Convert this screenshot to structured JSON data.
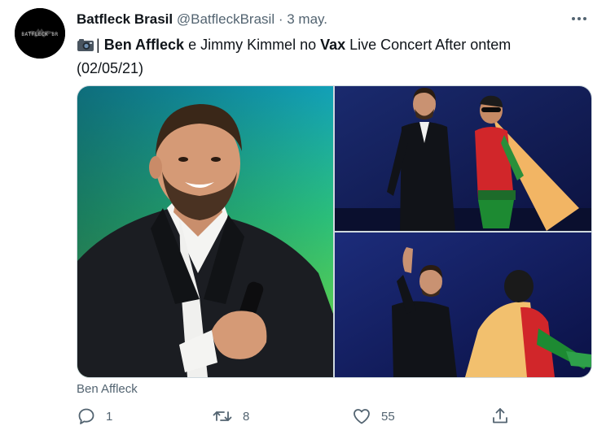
{
  "author": {
    "name": "Batfleck Brasil",
    "handle": "@BatfleckBrasil",
    "separator": "·",
    "date": "3 may.",
    "avatar_text": "BATFLECK BR"
  },
  "tweet": {
    "camera_icon": "camera-emoji-icon",
    "pipe": "|",
    "part1": "Ben Affleck",
    "part2": " e Jimmy Kimmel no ",
    "part3": "Vax",
    "part4": " Live Concert After ontem (02/05/21)"
  },
  "media": {
    "caption": "Ben Affleck"
  },
  "actions": {
    "reply_count": "1",
    "retweet_count": "8",
    "like_count": "55"
  },
  "icons": {
    "more": "more-options-icon",
    "reply": "reply-icon",
    "retweet": "retweet-icon",
    "like": "heart-icon",
    "share": "share-icon"
  },
  "colors": {
    "text": "#0f1419",
    "secondary": "#536471",
    "border": "#cfd9de"
  }
}
